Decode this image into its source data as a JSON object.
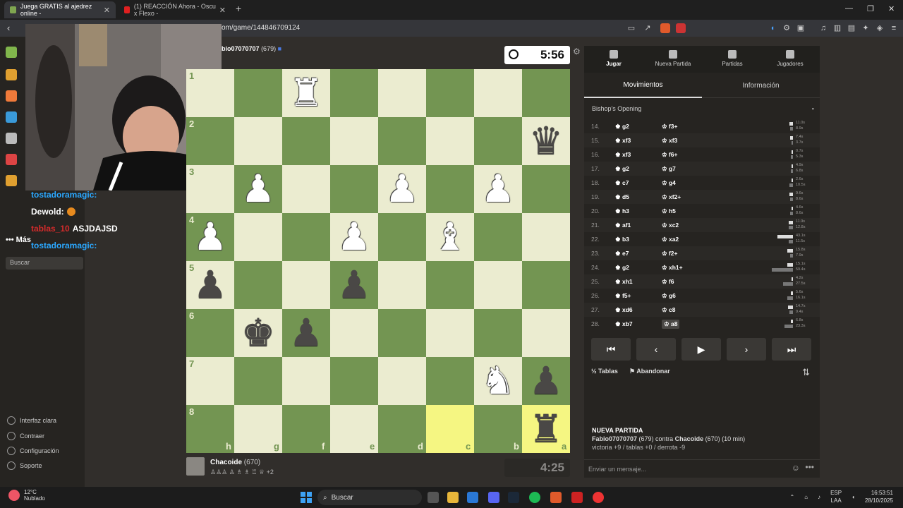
{
  "browser": {
    "tabs": [
      {
        "title": "Juega GRATIS al ajedrez online -",
        "active": true
      },
      {
        "title": "(1) REACCIÓN Ahora - Oscu x Flexo -",
        "active": false
      }
    ],
    "url": "om/game/144846709124"
  },
  "left_nav": {
    "more_label": "Más",
    "search_placeholder": "Buscar",
    "footer": [
      "Interfaz clara",
      "Contraer",
      "Configuración",
      "Soporte"
    ]
  },
  "chat": [
    {
      "user": "tostadoramagic:",
      "msg": "",
      "color": "#2ba8ff"
    },
    {
      "user": "Dewold:",
      "msg": "",
      "color": "#ffffff"
    },
    {
      "user": "tablas_10",
      "msg": "ASJDAJSD",
      "color": "#d42b2b"
    },
    {
      "user": "tostadoramagic:",
      "msg": "",
      "color": "#2ba8ff"
    }
  ],
  "opponent": {
    "name": "Fabio07070707",
    "rating": "(679)",
    "visible_name": "bio07070707"
  },
  "clock_top": "5:56",
  "clock_bottom": "4:25",
  "me": {
    "name": "Chacoide",
    "rating": "(670)",
    "captured_extra": "+2"
  },
  "board": {
    "ranks": [
      "1",
      "2",
      "3",
      "4",
      "5",
      "6",
      "7",
      "8"
    ],
    "files": [
      "h",
      "g",
      "f",
      "e",
      "d",
      "c",
      "b",
      "a"
    ],
    "pieces": [
      {
        "sq": "f1",
        "type": "rook",
        "color": "w"
      },
      {
        "sq": "a2",
        "type": "queen",
        "color": "b"
      },
      {
        "sq": "g3",
        "type": "pawn",
        "color": "w"
      },
      {
        "sq": "d3",
        "type": "pawn",
        "color": "w"
      },
      {
        "sq": "b3",
        "type": "pawn",
        "color": "w"
      },
      {
        "sq": "h4",
        "type": "pawn",
        "color": "w"
      },
      {
        "sq": "e4",
        "type": "pawn",
        "color": "w"
      },
      {
        "sq": "c4",
        "type": "bishop",
        "color": "w"
      },
      {
        "sq": "h5",
        "type": "pawn",
        "color": "b"
      },
      {
        "sq": "e5",
        "type": "pawn",
        "color": "b"
      },
      {
        "sq": "g6",
        "type": "king",
        "color": "b"
      },
      {
        "sq": "f6",
        "type": "pawn",
        "color": "b"
      },
      {
        "sq": "b7",
        "type": "knight",
        "color": "w"
      },
      {
        "sq": "a7",
        "type": "pawn",
        "color": "b"
      },
      {
        "sq": "a8",
        "type": "rook",
        "color": "b"
      }
    ],
    "highlights": [
      "c8",
      "a8"
    ]
  },
  "panel": {
    "top_tabs": [
      "Jugar",
      "Nueva Partida",
      "Partidas",
      "Jugadores"
    ],
    "sub_tabs": [
      "Movimientos",
      "Información"
    ],
    "opening": "Bishop's Opening",
    "moves": [
      {
        "n": "14.",
        "w": "g2",
        "b": "f3+",
        "tw": "11.0s",
        "tb": "8.9s"
      },
      {
        "n": "15.",
        "w": "xf3",
        "b": "xf3",
        "tw": "7.4s",
        "tb": "3.7s"
      },
      {
        "n": "16.",
        "w": "xf3",
        "b": "f6+",
        "tw": "0.7s",
        "tb": "5.3s"
      },
      {
        "n": "17.",
        "w": "g2",
        "b": "g7",
        "tw": "4.9s",
        "tb": "6.8s"
      },
      {
        "n": "18.",
        "w": "c7",
        "b": "g4",
        "tw": "2.6s",
        "tb": "10.5s"
      },
      {
        "n": "19.",
        "w": "d5",
        "b": "xf2+",
        "tw": "9.6s",
        "tb": "8.6s"
      },
      {
        "n": "20.",
        "w": "h3",
        "b": "h5",
        "tw": "4.6s",
        "tb": "8.6s"
      },
      {
        "n": "21.",
        "w": "af1",
        "b": "xc2",
        "tw": "11.9s",
        "tb": "12.8s"
      },
      {
        "n": "22.",
        "w": "b3",
        "b": "xa2",
        "tw": "43.1s",
        "tb": "11.5s"
      },
      {
        "n": "23.",
        "w": "e7",
        "b": "f2+",
        "tw": "15.8s",
        "tb": "7.9s"
      },
      {
        "n": "24.",
        "w": "g2",
        "b": "xh1+",
        "tw": "15.1s",
        "tb": "59.4s"
      },
      {
        "n": "25.",
        "w": "xh1",
        "b": "f6",
        "tw": "4.2s",
        "tb": "27.5s"
      },
      {
        "n": "26.",
        "w": "f5+",
        "b": "g6",
        "tw": "5.6s",
        "tb": "16.1s"
      },
      {
        "n": "27.",
        "w": "xd6",
        "b": "c8",
        "tw": "14.7s",
        "tb": "9.4s"
      },
      {
        "n": "28.",
        "w": "xb7",
        "b": "a8",
        "tw": "6.8s",
        "tb": "23.3s"
      }
    ],
    "draw_label": "Tablas",
    "resign_label": "Abandonar",
    "new_game_title": "NUEVA PARTIDA",
    "new_game_line_parts": [
      "Fabio07070707",
      " (679) contra ",
      "Chacoide",
      " (670) (10 min)"
    ],
    "new_game_stats": "victoria +9 / tablas +0 / derrota -9",
    "message_placeholder": "Enviar un mensaje..."
  },
  "taskbar": {
    "temp": "12°C",
    "weather": "Nublado",
    "search": "Buscar",
    "lang1": "ESP",
    "lang2": "LAA",
    "time": "16:53:51",
    "date": "28/10/2025"
  }
}
